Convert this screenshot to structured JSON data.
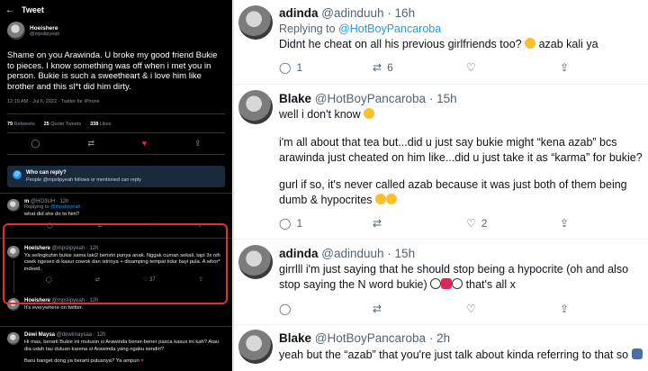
{
  "left": {
    "header_back": "←",
    "header_title": "Tweet",
    "main": {
      "name": "Hoeishere",
      "handle": "@mpslipyeah",
      "text": "Shame on you Arawinda. U broke my good friend Bukie to pieces. I know something was off when i met you in person. Bukie is such a sweetheart & i love him like brother and this sl*t did him dirty.",
      "meta": "12:19 AM · Jul 6, 2022 · Twitter for iPhone",
      "retweets": "79",
      "retweets_label": "Retweets",
      "quotes": "25",
      "quotes_label": "Quote Tweets",
      "likes": "338",
      "likes_label": "Likes"
    },
    "reply_box": {
      "title": "Who can reply?",
      "subtitle": "People @mpslipyeah follows or mentioned can reply"
    },
    "replies": [
      {
        "name": "m",
        "handle": "@HO3UH · 12h",
        "replying": "Replying to",
        "replying_to": "@mpslipyeah",
        "text": "what did she do to him?"
      },
      {
        "name": "Hoeishere",
        "handle": "@mpslipyeah · 12h",
        "text": "Ya selingkuhin bukie sama laki2 beristri punya anak. Nggak cuman sekali, tapi 3x nih cwek ngesex di kasur cowok dan istrinya + disamping tempat tidur bayi pula. A whor* indeed.",
        "likes": "37"
      },
      {
        "name": "Hoeishere",
        "handle": "@mpslipyeah · 12h",
        "text": "It's everywhere on twitter."
      },
      {
        "name": "Dewi Maysa",
        "handle": "@dewimaysaa · 12h",
        "text": "Hi mas, berarti Bukie ini mutusin si Arawinda bener-bener pasca kasus ini kah? Atau dia udah tau duluan karena si Arawinda yang ngaku sendiri?",
        "text2": "Baru banget dong ya berarti putusnya? Ya ampun"
      }
    ]
  },
  "right": {
    "tweets": [
      {
        "name": "adinda",
        "handle": "@adinduuh",
        "time": "16h",
        "replying": "Replying to",
        "replying_to": "@HotBoyPancaroba",
        "text": "Didnt he cheat on all his previous girlfriends too?",
        "text_tail": "azab kali ya",
        "replies": "1",
        "retweets": "6",
        "likes": ""
      },
      {
        "name": "Blake",
        "handle": "@HotBoyPancaroba",
        "time": "15h",
        "p1": "well i don't know",
        "p2": "i'm all about that tea but...did u just say bukie might “kena azab” bcs arawinda just cheated on him like...did u just take it as “karma” for bukie?",
        "p3": "gurl if so, it's never called azab because it was just both of them being dumb & hypocrites",
        "replies": "1",
        "retweets": "",
        "likes": "2"
      },
      {
        "name": "adinda",
        "handle": "@adinduuh",
        "time": "15h",
        "text": "girrlll i'm just saying that he should stop being a hypocrite (oh and also stop saying the N word bukie)",
        "text_tail": "that's all x",
        "replies": "",
        "retweets": "",
        "likes": ""
      },
      {
        "name": "Blake",
        "handle": "@HotBoyPancaroba",
        "time": "2h",
        "text": "yeah but the “azab” that you're just talk about kinda referring to that so"
      }
    ]
  }
}
